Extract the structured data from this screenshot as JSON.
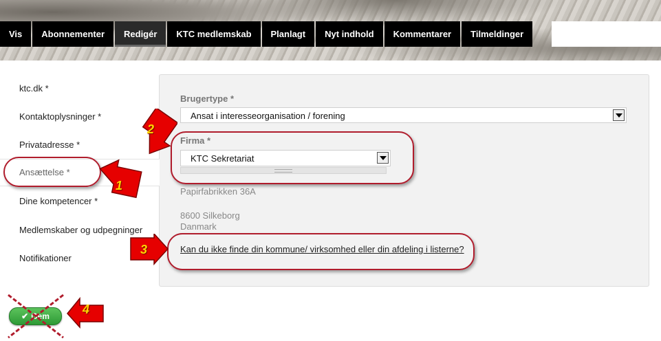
{
  "tabs": [
    {
      "label": "Vis"
    },
    {
      "label": "Abonnementer"
    },
    {
      "label": "Redigér"
    },
    {
      "label": "KTC medlemskab"
    },
    {
      "label": "Planlagt"
    },
    {
      "label": "Nyt indhold"
    },
    {
      "label": "Kommentarer"
    },
    {
      "label": "Tilmeldinger"
    }
  ],
  "active_tab": "Redigér",
  "sidebar": {
    "items": [
      {
        "label": "ktc.dk *"
      },
      {
        "label": "Kontaktoplysninger *"
      },
      {
        "label": "Privatadresse *"
      },
      {
        "label": "Ansættelse *"
      },
      {
        "label": "Dine kompetencer *"
      },
      {
        "label": "Medlemskaber og udpegninger"
      },
      {
        "label": "Notifikationer"
      }
    ],
    "active": "Ansættelse *"
  },
  "form": {
    "brugertype_label": "Brugertype *",
    "brugertype_value": "Ansat i interesseorganisation / forening",
    "firma_label": "Firma *",
    "firma_value": "KTC Sekretariat",
    "address_street": "Papirfabrikken 36A",
    "address_city": "8600 Silkeborg",
    "address_country": "Danmark",
    "help_link": "Kan du ikke finde din kommune/ virksomhed eller din afdeling i listerne?"
  },
  "save_button": {
    "label": "Gem"
  },
  "annotations": [
    {
      "number": "1"
    },
    {
      "number": "2"
    },
    {
      "number": "3"
    },
    {
      "number": "4"
    }
  ],
  "colors": {
    "annotation_red": "#b01c2c",
    "badge_red": "#e00000",
    "badge_yellow": "#ffd400",
    "save_green": "#3aa63f"
  }
}
